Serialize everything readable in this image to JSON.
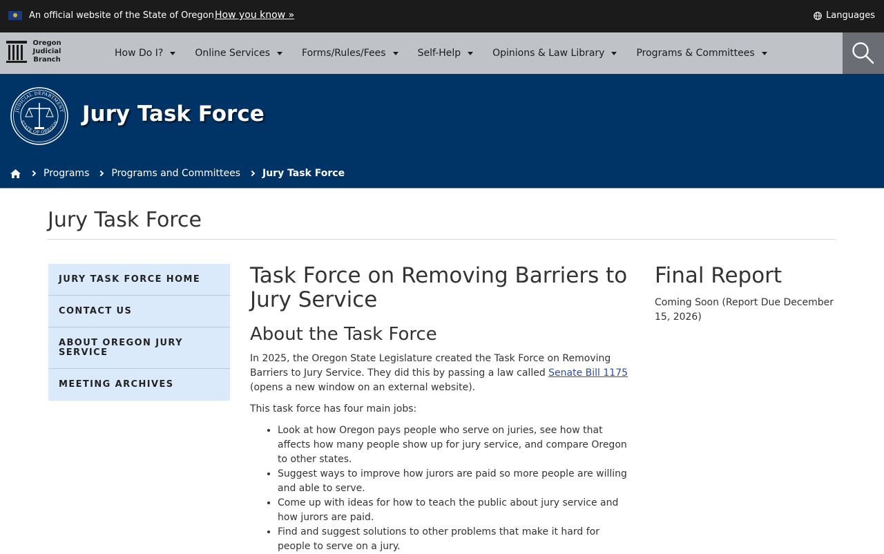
{
  "official_banner": {
    "text": "An official website of the State of Oregon",
    "how_link": "How you know »",
    "languages": "Languages"
  },
  "nav": {
    "logo_text": "Oregon Judicial Branch",
    "items": [
      {
        "label": "How Do I?"
      },
      {
        "label": "Online Services"
      },
      {
        "label": "Forms/Rules/Fees"
      },
      {
        "label": "Self-Help"
      },
      {
        "label": "Opinions & Law Library"
      },
      {
        "label": "Programs & Committees"
      }
    ]
  },
  "hero": {
    "title": "Jury Task Force",
    "seal_text": "JUDICIAL DEPARTMENT · STATE OF OREGON",
    "breadcrumb": [
      "Programs",
      "Programs and Committees"
    ],
    "breadcrumb_current": "Jury Task Force"
  },
  "page": {
    "title": "Jury Task Force"
  },
  "side_nav": {
    "items": [
      {
        "label": "JURY TASK FORCE HOME"
      },
      {
        "label": "CONTACT US"
      },
      {
        "label": "ABOUT OREGON JURY SERVICE"
      },
      {
        "label": "MEETING ARCHIVES"
      }
    ]
  },
  "main": {
    "heading": "Task Force on Removing Barriers to Jury Service",
    "subheading": "About the Task Force",
    "intro_before_link": "In 2025, the Oregon State Legislature created the Task Force on Removing Barriers to Jury Service. They did this by passing a law called ",
    "intro_link": "Senate Bill 1175",
    "intro_after_link": " (opens a new window on an external website).",
    "jobs_intro": "This task force has four main jobs:",
    "jobs": [
      "Look at how Oregon pays people who serve on juries, see how that affects how many people show up for jury service, and compare Oregon to other states.",
      "Suggest ways to improve how jurors are paid so more people are willing and able to serve.",
      "Come up with ideas for how to teach the public about jury service and how jurors are paid.",
      "Find and suggest solutions to other problems that make it hard for people to serve on a jury."
    ]
  },
  "right": {
    "heading": "Final Report",
    "text": "Coming Soon (Report Due December 15, 2026)"
  },
  "colors": {
    "official_bar": "#1b1b1b",
    "nav_bar": "#bfc3c8",
    "search_box": "#6a6e74",
    "hero": "#003366",
    "side_nav": "#dbeafa",
    "link": "#2a4b9e"
  }
}
